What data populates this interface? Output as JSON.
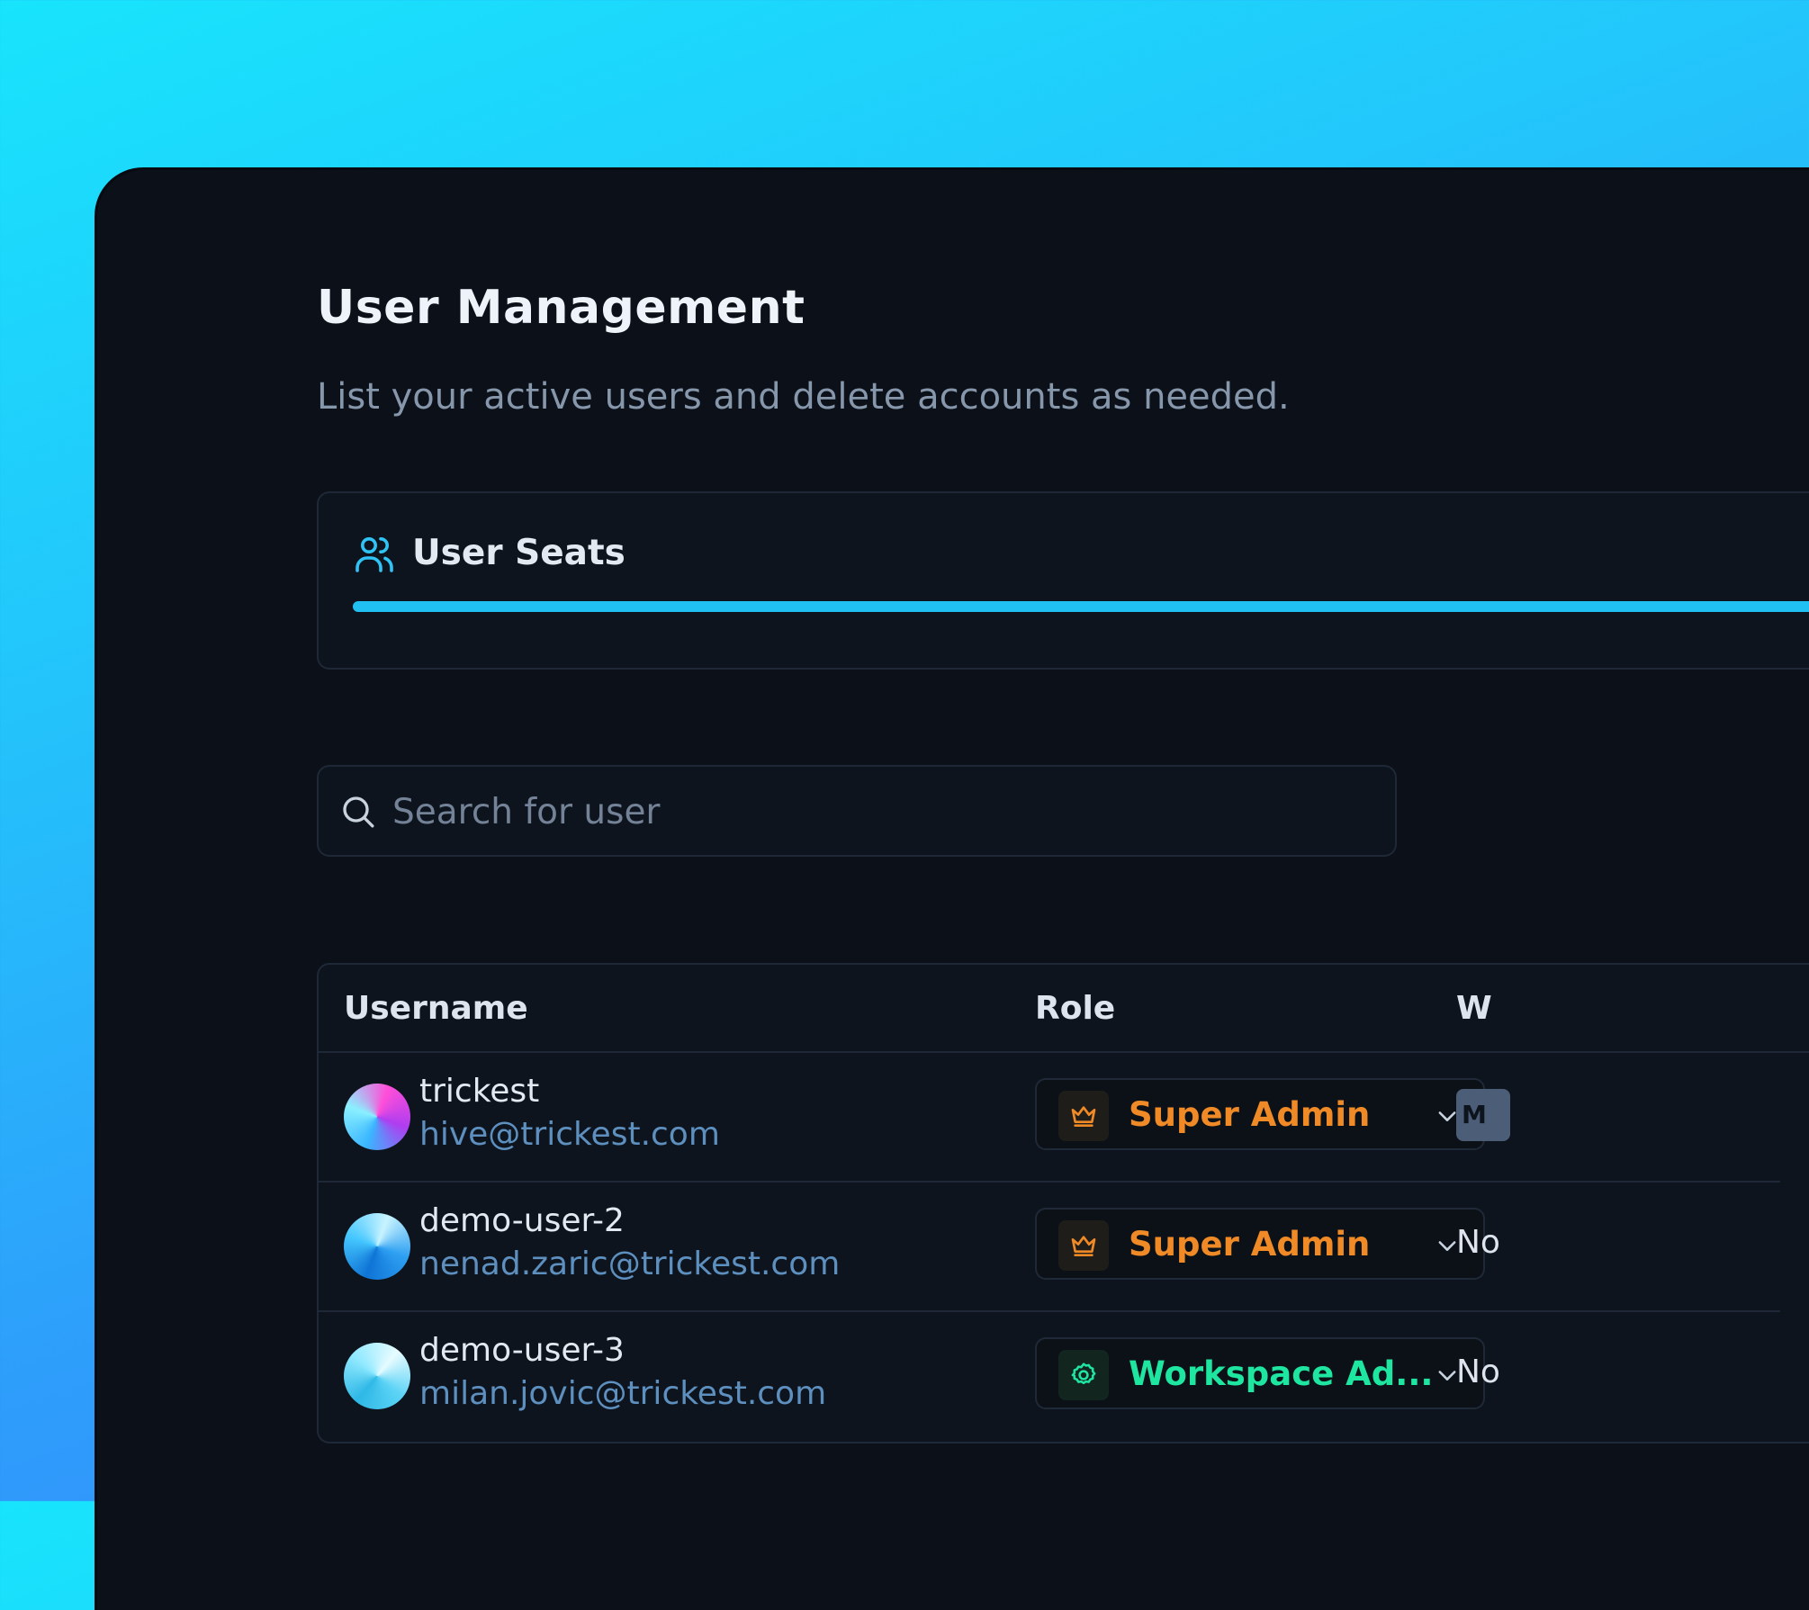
{
  "page": {
    "title": "User Management",
    "subtitle": "List your active users and delete accounts as needed."
  },
  "seats": {
    "label": "User Seats",
    "icon": "users-icon",
    "fill_fraction": 1.0,
    "bar_color": "#20c0f2"
  },
  "search": {
    "placeholder": "Search for user",
    "value": "",
    "icon": "search-icon"
  },
  "table": {
    "columns": [
      "Username",
      "Role",
      "W"
    ],
    "rows": [
      {
        "username": "trickest",
        "email": "hive@trickest.com",
        "role": "Super Admin",
        "role_icon": "crown-icon",
        "role_color": "#f08a26",
        "workspace": "M"
      },
      {
        "username": "demo-user-2",
        "email": "nenad.zaric@trickest.com",
        "role": "Super Admin",
        "role_icon": "crown-icon",
        "role_color": "#f08a26",
        "workspace": "No"
      },
      {
        "username": "demo-user-3",
        "email": "milan.jovic@trickest.com",
        "role": "Workspace Ad...",
        "role_icon": "gear-icon",
        "role_color": "#1ee6a0",
        "workspace": "No"
      }
    ]
  },
  "colors": {
    "panel_bg": "#0c1119",
    "accent": "#20c0f2",
    "email_text": "#5d8fbf"
  }
}
